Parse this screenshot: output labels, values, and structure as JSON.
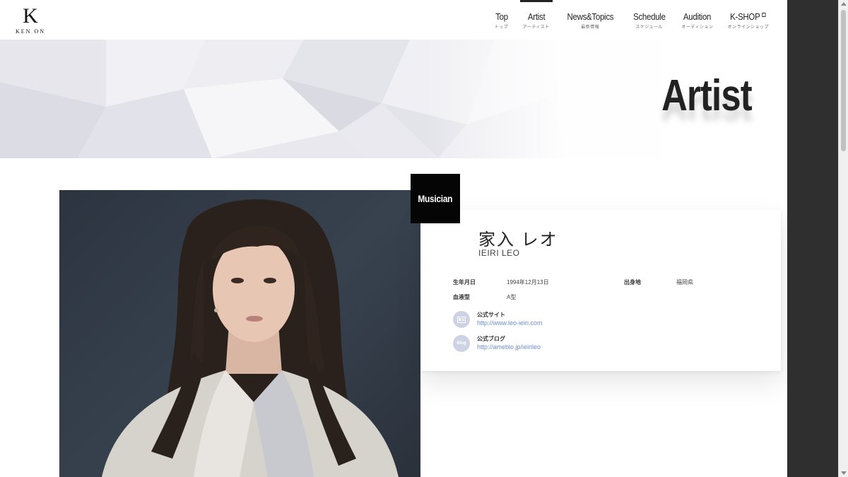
{
  "header": {
    "logo_mark": "K",
    "logo_text": "KEN ON",
    "nav": [
      {
        "label": "Top",
        "sub": "トップ"
      },
      {
        "label": "Artist",
        "sub": "アーティスト"
      },
      {
        "label": "News&Topics",
        "sub": "最新情報"
      },
      {
        "label": "Schedule",
        "sub": "スケジュール"
      },
      {
        "label": "Audition",
        "sub": "オーディション"
      },
      {
        "label": "K-SHOP",
        "sub": "オンラインショップ"
      }
    ],
    "active_nav": "Artist"
  },
  "hero": {
    "title": "Artist"
  },
  "artist": {
    "category": "Musician",
    "name_ja": "家入 レオ",
    "name_en": "IEIRI LEO",
    "profile": {
      "birthday_label": "生年月日",
      "birthday_value": "1994年12月13日",
      "hometown_label": "出身地",
      "hometown_value": "福岡県",
      "blood_label": "血液型",
      "blood_value": "A型"
    },
    "links": [
      {
        "icon": "website-icon",
        "title": "公式サイト",
        "url": "http://www.leo-ieiri.com"
      },
      {
        "icon": "blog-icon",
        "icon_text": "Blog",
        "title": "公式ブログ",
        "url": "http://ameblo.jp/ieirileo"
      }
    ]
  },
  "colors": {
    "tag_bg": "#050505",
    "link_color": "#6d8fc9",
    "icon_circle": "#cdd3e4",
    "side_dark": "#2f2f2f"
  }
}
